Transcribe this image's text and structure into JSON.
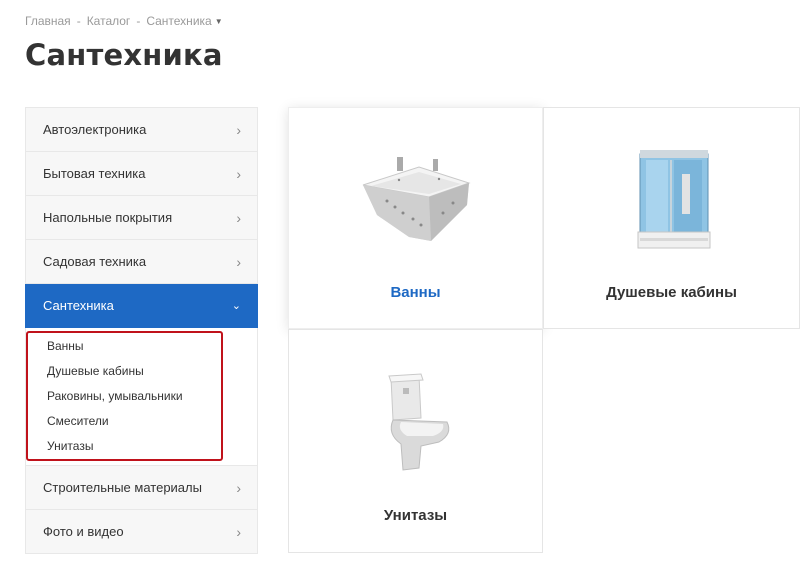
{
  "breadcrumb": {
    "items": [
      "Главная",
      "Каталог",
      "Сантехника"
    ],
    "separator": "-"
  },
  "page": {
    "title": "Сантехника"
  },
  "sidebar": {
    "items": [
      {
        "label": "Автоэлектроника",
        "icon": "chevron-right-icon"
      },
      {
        "label": "Бытовая техника",
        "icon": "chevron-right-icon"
      },
      {
        "label": "Напольные покрытия",
        "icon": "chevron-right-icon"
      },
      {
        "label": "Садовая техника",
        "icon": "chevron-right-icon"
      },
      {
        "label": "Сантехника",
        "icon": "chevron-down-icon",
        "active": true
      },
      {
        "label": "Строительные материалы",
        "icon": "chevron-right-icon"
      },
      {
        "label": "Фото и видео",
        "icon": "chevron-right-icon"
      }
    ],
    "submenu": [
      "Ванны",
      "Душевые кабины",
      "Раковины, умывальники",
      "Смесители",
      "Унитазы"
    ]
  },
  "cards": [
    {
      "title": "Ванны",
      "image": "bathtub-image"
    },
    {
      "title": "Душевые кабины",
      "image": "shower-cabin-image"
    },
    {
      "title": "Унитазы",
      "image": "toilet-image"
    }
  ],
  "colors": {
    "accent": "#1e69c4",
    "highlight_border": "#c0121b"
  }
}
